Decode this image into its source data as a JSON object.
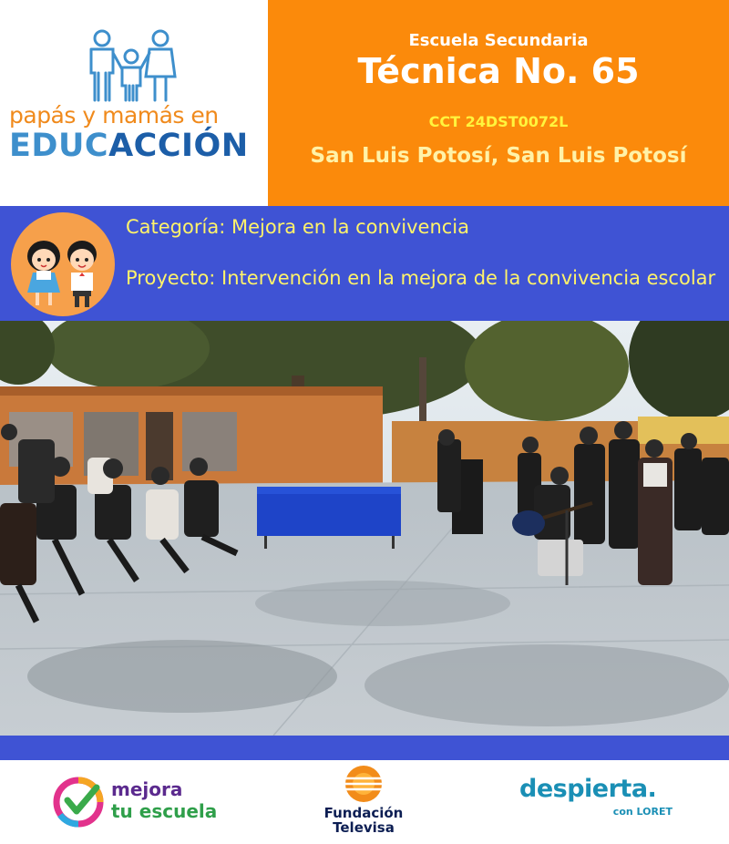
{
  "logo": {
    "line1": "papás y mamás en",
    "line2_part1": "EDUC",
    "line2_part2": "ACCIÓN",
    "colors": {
      "orange": "#f08a1c",
      "light_blue": "#3e8fcc",
      "dark_blue": "#1c5ea8"
    }
  },
  "school": {
    "subtitle": "Escuela Secundaria",
    "name": "Técnica No. 65",
    "cct": "CCT 24DST0072L",
    "location": "San Luis Potosí, San Luis Potosí",
    "panel_color": "#fb8a0b"
  },
  "category_band": {
    "category": "Categoría: Mejora en la convivencia",
    "project": "Proyecto: Intervención en la mejora de la convivencia escolar",
    "band_color": "#3f53d4",
    "text_color": "#fff36a",
    "badge_icon": "kids-icon"
  },
  "photo": {
    "icon": "school-event-photo"
  },
  "footer": {
    "mejora_line1": "mejora",
    "mejora_line2": "tu escuela",
    "televisa_line1": "Fundación",
    "televisa_line2": "Televisa",
    "despierta_main": "despierta.",
    "despierta_sub": "con LORET"
  }
}
